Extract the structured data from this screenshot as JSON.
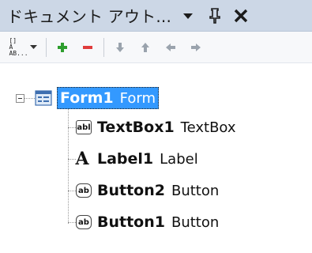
{
  "panel": {
    "title": "ドキュメント アウト...",
    "colors": {
      "titlebar": "#ccd7e6",
      "selection": "#3399ff",
      "add": "#2e9e2e",
      "remove": "#e03c3c",
      "arrow": "#9aa3ad"
    }
  },
  "toolbar": {
    "sort_icon_lines": [
      "[]",
      "A",
      "AB..."
    ]
  },
  "tree": {
    "root": {
      "name": "Form1",
      "type": "Form"
    },
    "children": [
      {
        "name": "TextBox1",
        "type": "TextBox",
        "icon": "textbox-icon",
        "icon_text": "abl"
      },
      {
        "name": "Label1",
        "type": "Label",
        "icon": "label-icon",
        "icon_text": "A"
      },
      {
        "name": "Button2",
        "type": "Button",
        "icon": "button-icon",
        "icon_text": "ab"
      },
      {
        "name": "Button1",
        "type": "Button",
        "icon": "button-icon",
        "icon_text": "ab"
      }
    ]
  }
}
